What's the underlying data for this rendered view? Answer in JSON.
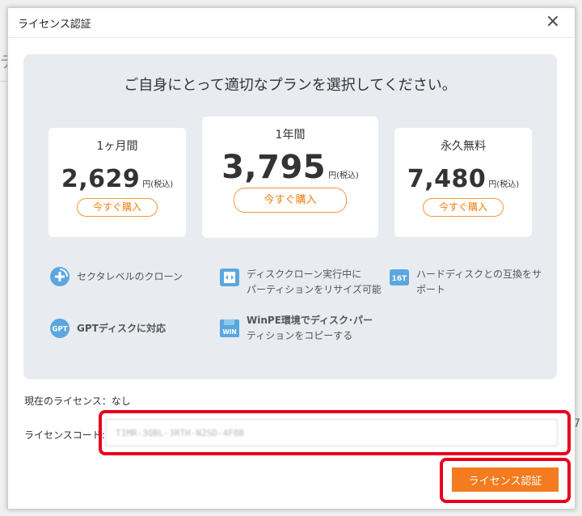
{
  "window": {
    "title": "ライセンス認証",
    "close_symbol": "×"
  },
  "background": {
    "left_glyph": "デ",
    "right_glyph": "7"
  },
  "headline": "ご自身にとって適切なプランを選択してください。",
  "plans": [
    {
      "name": "1ヶ月間",
      "price": "2,629",
      "unit": "円(税込)",
      "button": "今すぐ購入"
    },
    {
      "name": "1年間",
      "price": "3,795",
      "unit": "円(税込)",
      "button": "今すぐ購入"
    },
    {
      "name": "永久無料",
      "price": "7,480",
      "unit": "円(税込)",
      "button": "今すぐ購入"
    }
  ],
  "features": [
    {
      "icon": "clone-plus-icon",
      "lines": [
        "セクタレベルのクローン"
      ]
    },
    {
      "icon": "disk-resize-icon",
      "lines": [
        "ディスククローン実行中に",
        "パーティションをリサイズ可能"
      ]
    },
    {
      "icon": "16t-disk-icon",
      "icon_text": "16T",
      "lines": [
        "ハードディスクとの互換をサ",
        "ポート"
      ]
    },
    {
      "icon": "gpt-icon",
      "icon_text": "GPT",
      "lines": [
        "GPTディスクに対応"
      ]
    },
    {
      "icon": "winpe-icon",
      "icon_text": "WIN",
      "lines": [
        "WinPE環境でディスク･パー",
        "ティションをコピーする"
      ]
    }
  ],
  "license": {
    "current_label": "現在のライセンス：",
    "current_value": "なし",
    "code_label": "ライセンスコード:",
    "code_value": "T1MR-3QBL-3RTH-N2SD-4F8B",
    "activate_label": "ライセンス認証"
  },
  "colors": {
    "accent": "#f47b20",
    "highlight": "#e8001c",
    "panel": "#e8ebef",
    "icon": "#5aa7e0"
  }
}
